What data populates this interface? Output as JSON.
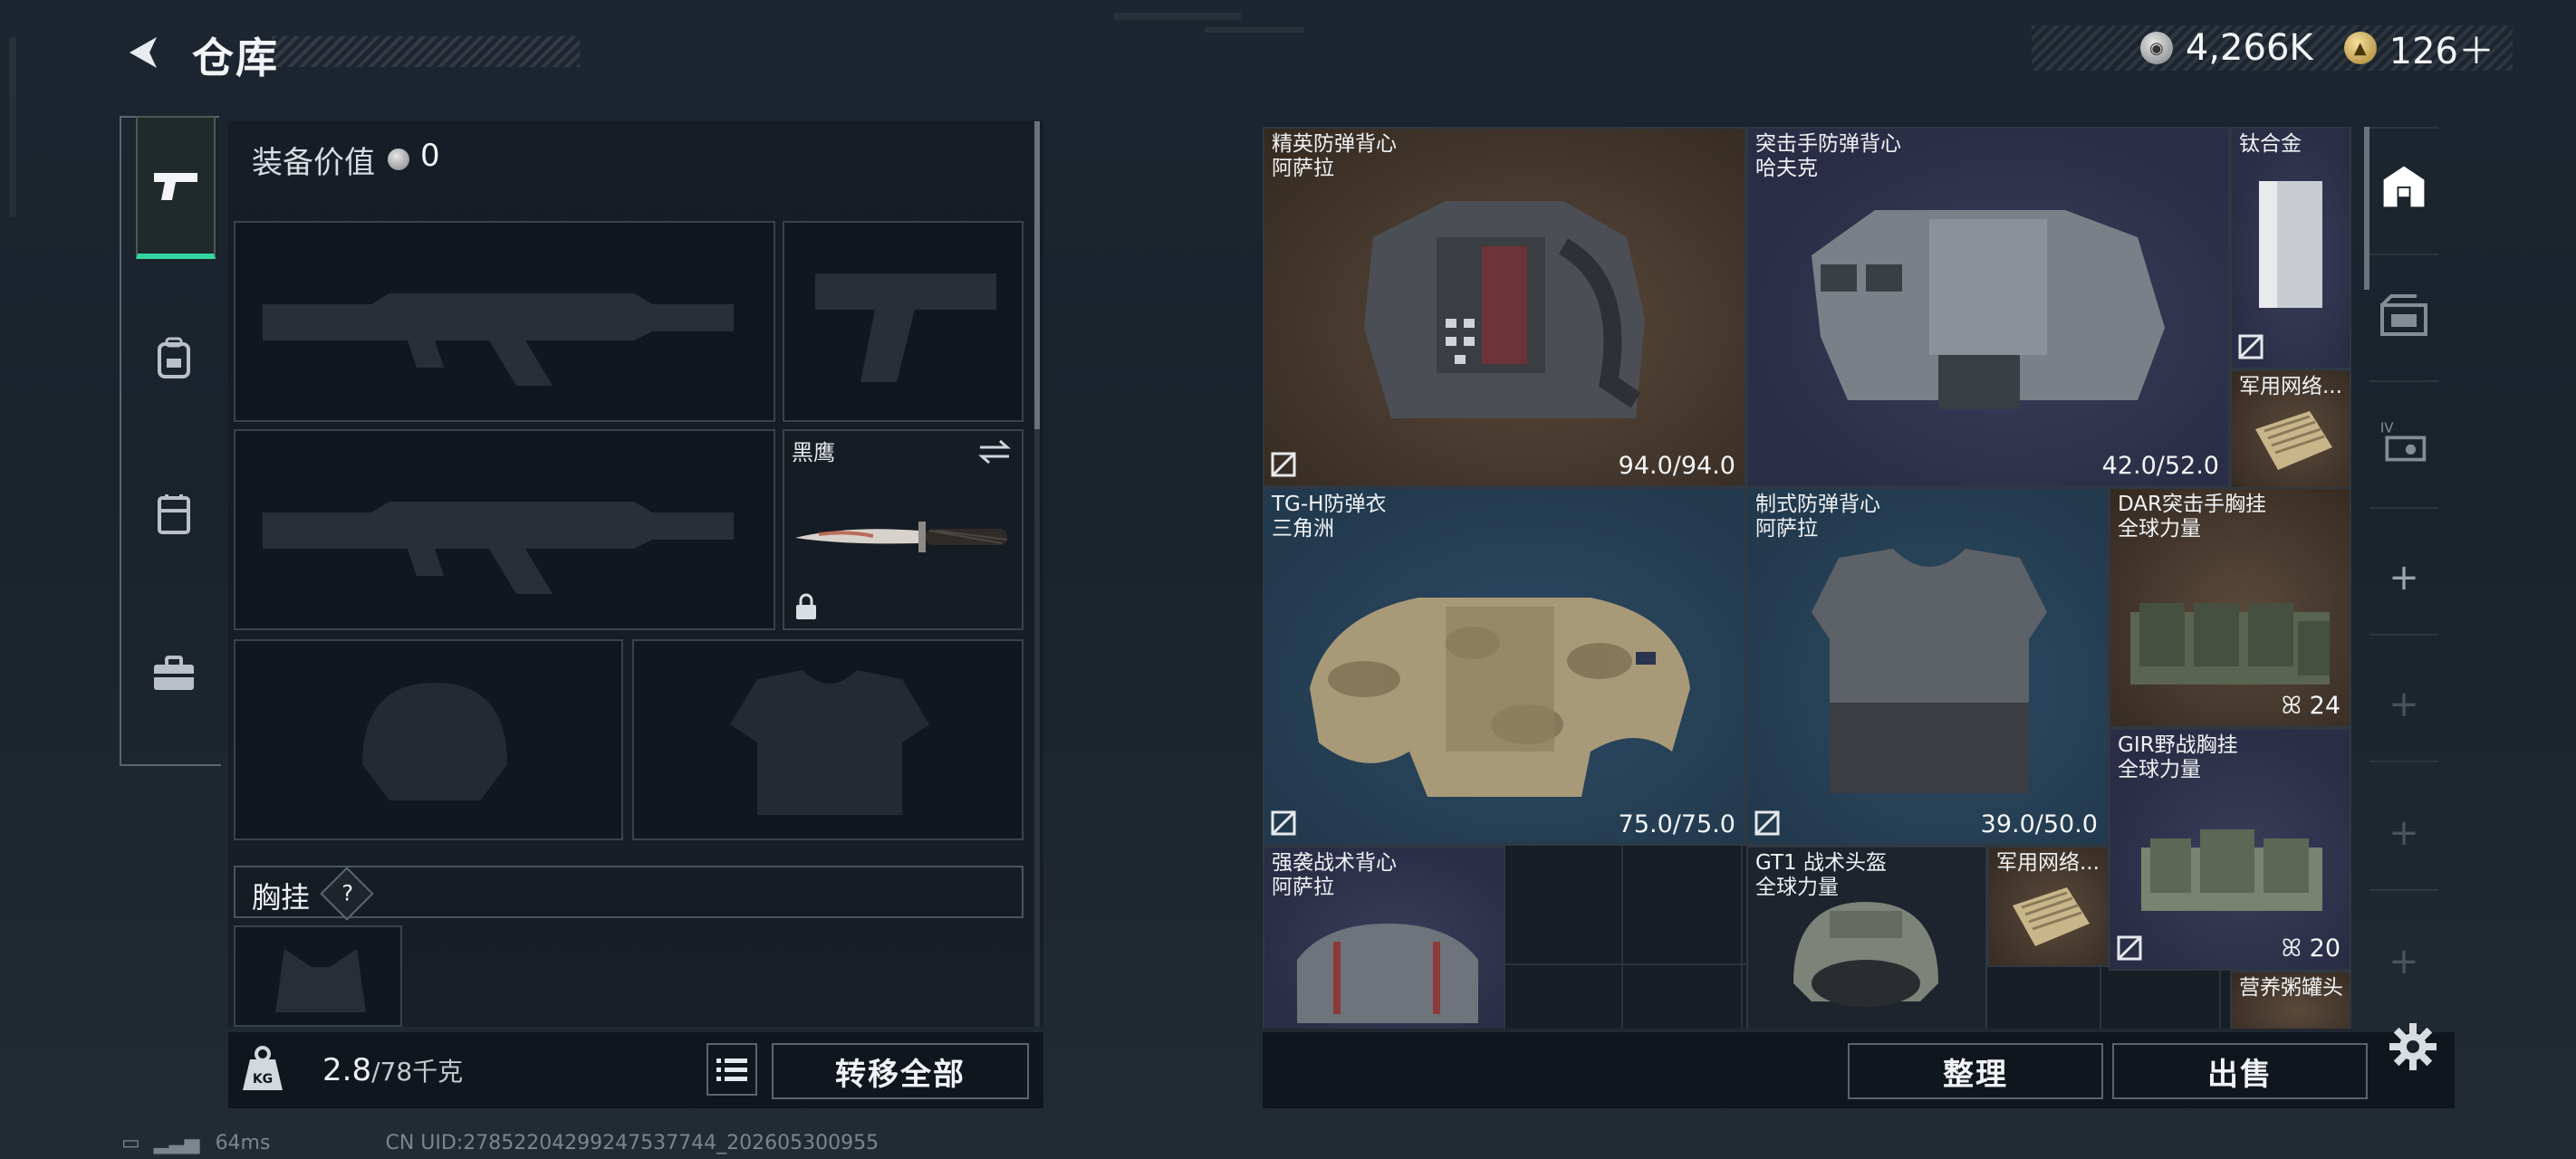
{
  "header": {
    "back_label": "<",
    "title": "仓库"
  },
  "currency": [
    {
      "icon": "silver-coin-icon",
      "value": "4,266K"
    },
    {
      "icon": "gold-coin-icon",
      "value": "126＋"
    }
  ],
  "left_nav": [
    "pistol-icon",
    "backpack-icon",
    "chest-rig-icon",
    "toolbox-icon"
  ],
  "loadout": {
    "value_label": "装备价值",
    "value": "0",
    "knife_name": "黑鹰",
    "chest_label": "胸挂",
    "chest_help": "?"
  },
  "weight": {
    "current": "2.8",
    "max": "/78千克"
  },
  "buttons": {
    "transfer_all": "转移全部",
    "sort": "整理",
    "sell": "出售"
  },
  "storage_items": [
    {
      "name": "精英防弹背心",
      "sub": "阿萨拉",
      "durability": "94.0/94.0"
    },
    {
      "name": "突击手防弹背心",
      "sub": "哈夫克",
      "durability": "42.0/52.0"
    },
    {
      "name": "钛合金",
      "sub": ""
    },
    {
      "name": "军用网络...",
      "sub": ""
    },
    {
      "name": "TG-H防弹衣",
      "sub": "三角洲",
      "durability": "75.0/75.0"
    },
    {
      "name": "制式防弹背心",
      "sub": "阿萨拉",
      "durability": "39.0/50.0"
    },
    {
      "name": "DAR突击手胸挂",
      "sub": "全球力量",
      "count": "24"
    },
    {
      "name": "GIR野战胸挂",
      "sub": "全球力量",
      "count": "20"
    },
    {
      "name": "强袭战术背心",
      "sub": "阿萨拉"
    },
    {
      "name": "GT1 战术头盔",
      "sub": "全球力量"
    },
    {
      "name": "军用网络...",
      "sub": ""
    },
    {
      "name": "营养粥罐头",
      "sub": ""
    }
  ],
  "right_nav": [
    "storage-icon",
    "warehouse-icon",
    "tier-iv-icon",
    "plus-icon",
    "plus-icon",
    "plus-icon",
    "plus-icon"
  ],
  "status": {
    "ping": "64ms",
    "uid": "CN UID:27852204299247537744_202605300955"
  },
  "colors": {
    "accent": "#33d6a0",
    "panel": "#171e26"
  }
}
